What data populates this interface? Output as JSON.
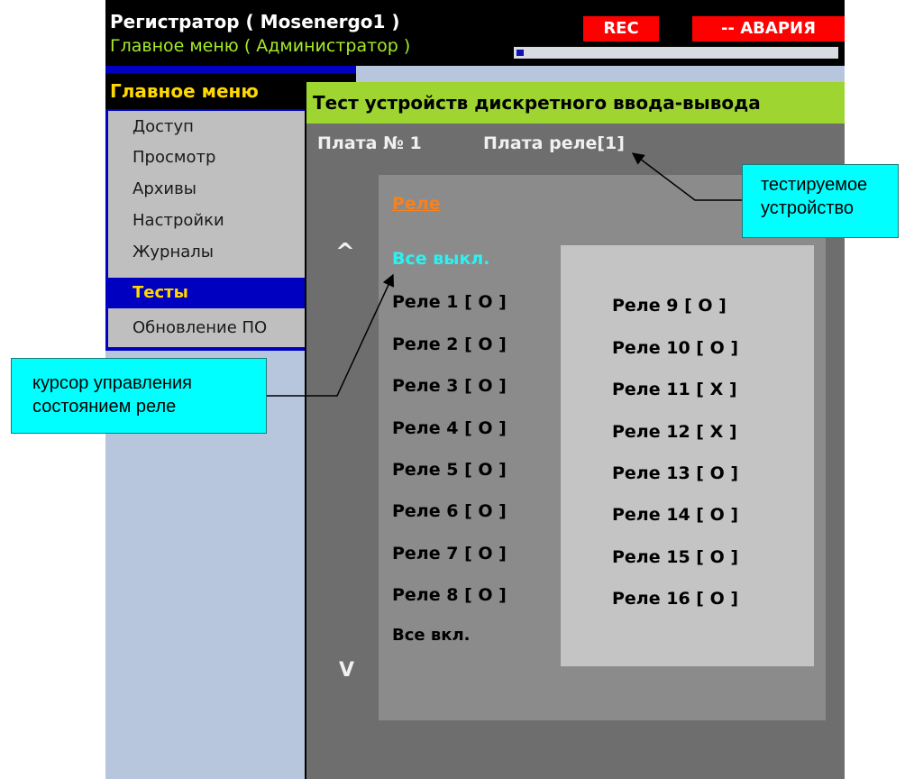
{
  "header": {
    "title": "Регистратор ( Mosenergo1 )",
    "subtitle": "Главное меню ( Администратор )",
    "rec_badge": "REC",
    "alarm_badge": "-- АВАРИЯ"
  },
  "main_menu": {
    "title": "Главное меню",
    "items": [
      {
        "label": "Доступ",
        "selected": false
      },
      {
        "label": "Просмотр",
        "selected": false
      },
      {
        "label": "Архивы",
        "selected": false
      },
      {
        "label": "Настройки",
        "selected": false
      },
      {
        "label": "Журналы",
        "selected": false
      },
      {
        "label": "Тесты",
        "selected": true
      },
      {
        "label": "Обновление ПО",
        "selected": false
      }
    ]
  },
  "dialog": {
    "title": "Тест устройств дискретного ввода-вывода",
    "board_number": "Плата № 1",
    "board_name": "Плата реле[1]",
    "section_label": "Реле",
    "all_off": "Все выкл.",
    "all_on": "Все вкл.",
    "scroll_up": "^",
    "scroll_down": "V",
    "relays_left": [
      "Реле 1 [ O ]",
      "Реле 2 [ O ]",
      "Реле 3 [ O ]",
      "Реле 4 [ O ]",
      "Реле 5 [ O ]",
      "Реле 6 [ O ]",
      "Реле 7 [ O ]",
      "Реле 8 [ O ]"
    ],
    "relays_right": [
      "Реле 9 [ O ]",
      "Реле 10 [ O ]",
      "Реле 11 [ X ]",
      "Реле 12 [ X ]",
      "Реле 13 [ O ]",
      "Реле 14 [ O ]",
      "Реле 15 [ O ]",
      "Реле 16 [ O ]"
    ]
  },
  "callouts": {
    "device": "тестируемое\nустройство",
    "cursor": "курсор управления\nсостоянием реле"
  },
  "colors": {
    "alarm": "#ff0000",
    "title_bar": "#9ed530",
    "menu_selected": "#0000c0",
    "cursor_text": "#2ff0f0",
    "callout": "#00ffff"
  }
}
